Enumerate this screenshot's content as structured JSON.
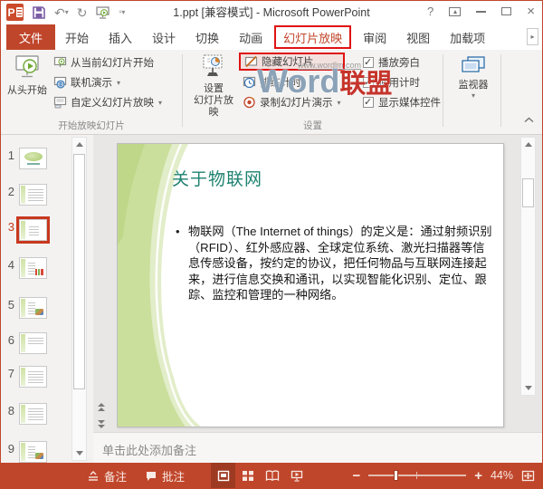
{
  "titlebar": {
    "title": "1.ppt [兼容模式] - Microsoft PowerPoint"
  },
  "icons": {
    "help": "?",
    "close": "×",
    "undo": "↶",
    "redo": "↻",
    "dropdown": "▾",
    "overflow": "▸",
    "minus": "−",
    "plus": "+",
    "collapse": "︿",
    "bullet": "•",
    "ppt_logo_letter": "P",
    "qat_caret": "▾"
  },
  "tabs": {
    "file": "文件",
    "items": [
      "开始",
      "插入",
      "设计",
      "切换",
      "动画",
      "幻灯片放映",
      "审阅",
      "视图",
      "加载项"
    ]
  },
  "ribbon": {
    "start_group": {
      "label": "开始放映幻灯片",
      "from_beginning": "从头开始",
      "from_current": "从当前幻灯片开始",
      "present_online": "联机演示",
      "custom_show": "自定义幻灯片放映"
    },
    "setup_group": {
      "label": "设置",
      "setup_show_line1": "设置",
      "setup_show_line2": "幻灯片放映",
      "hide_slide": "隐藏幻灯片",
      "rehearse": "排练计时",
      "record": "录制幻灯片演示",
      "play_narrations": "播放旁白",
      "use_timings": "使用计时",
      "show_media": "显示媒体控件"
    },
    "monitors_group": {
      "monitors": "监视器"
    }
  },
  "watermark": {
    "url": "www.wordlm.com",
    "brand_en": "Word",
    "brand_cn": "联盟"
  },
  "slides_panel": {
    "selected": "3",
    "items": [
      "1",
      "2",
      "3",
      "4",
      "5",
      "6",
      "7",
      "8",
      "9"
    ]
  },
  "slide": {
    "title": "关于物联网",
    "bullet": "物联网（The Internet of things）的定义是：通过射频识别（RFID）、红外感应器、全球定位系统、激光扫描器等信息传感设备，按约定的协议，把任何物品与互联网连接起来，进行信息交换和通讯，以实现智能化识别、定位、跟踪、监控和管理的一种网络。"
  },
  "notes": {
    "placeholder": "单击此处添加备注"
  },
  "statusbar": {
    "notes": "备注",
    "comments": "批注",
    "zoom_level": "44%"
  },
  "colors": {
    "accent": "#C0462B",
    "annotation_red": "#E01212",
    "title_teal": "#1E8270",
    "theme_green": "#C7DC96"
  }
}
